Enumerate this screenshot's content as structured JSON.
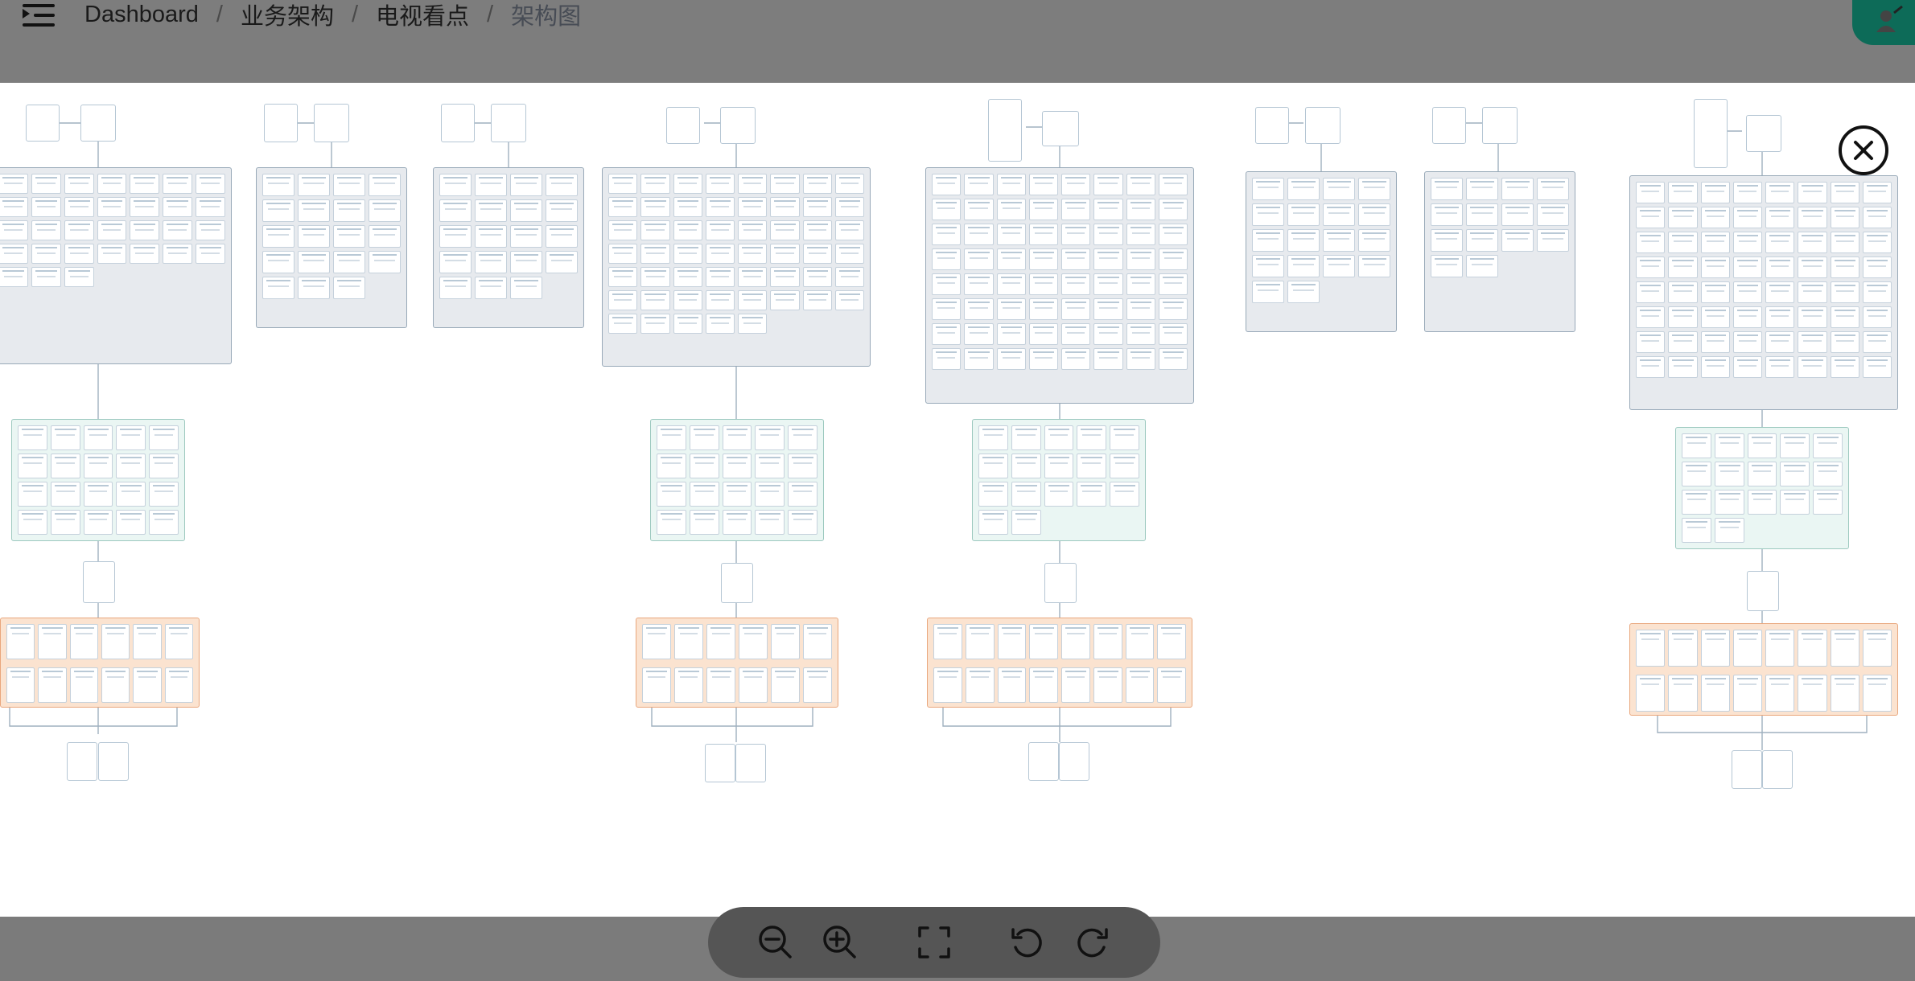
{
  "header": {
    "breadcrumb": [
      "Dashboard",
      "业务架构",
      "电视看点",
      "架构图"
    ],
    "separator": "/"
  },
  "icons": {
    "menu": "menu-toggle-icon",
    "badge": "user-badge-icon",
    "close": "close-icon",
    "zoom_out": "zoom-out-icon",
    "zoom_in": "zoom-in-icon",
    "fit": "fit-screen-icon",
    "rotate_left": "rotate-left-icon",
    "rotate_right": "rotate-right-icon"
  },
  "colors": {
    "overlay": "#7b7b7b",
    "badge": "#0d6b58",
    "group_gray": "#e7eaee",
    "group_green": "#eaf6f3",
    "group_orange": "#fbe3d0",
    "toolbar": "#555555"
  }
}
